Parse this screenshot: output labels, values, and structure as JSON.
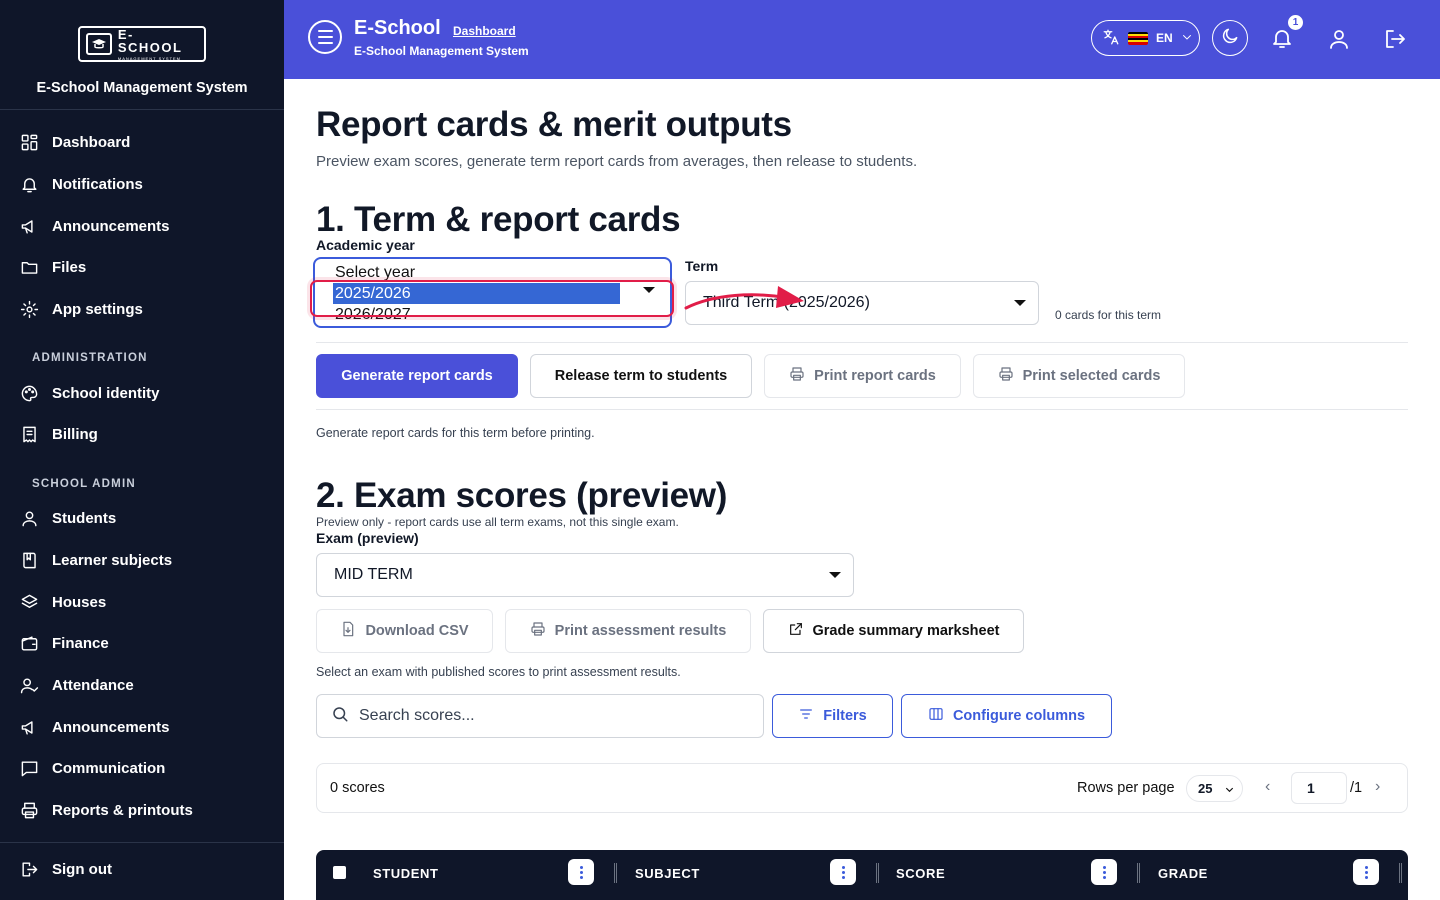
{
  "sidebar": {
    "logo_text": "E-SCHOOL",
    "logo_sub": "MANAGEMENT SYSTEM",
    "brand_name": "E-School Management System",
    "items_top": [
      {
        "label": "Dashboard",
        "icon": "dashboard-icon"
      },
      {
        "label": "Notifications",
        "icon": "bell-icon"
      },
      {
        "label": "Announcements",
        "icon": "megaphone-icon"
      },
      {
        "label": "Files",
        "icon": "folder-icon"
      },
      {
        "label": "App settings",
        "icon": "gear-icon"
      }
    ],
    "section_admin": "ADMINISTRATION",
    "items_admin": [
      {
        "label": "School identity",
        "icon": "palette-icon"
      },
      {
        "label": "Billing",
        "icon": "receipt-icon"
      }
    ],
    "section_school": "SCHOOL ADMIN",
    "items_school": [
      {
        "label": "Students",
        "icon": "user-icon"
      },
      {
        "label": "Learner subjects",
        "icon": "book-icon"
      },
      {
        "label": "Houses",
        "icon": "layers-icon"
      },
      {
        "label": "Finance",
        "icon": "wallet-icon"
      },
      {
        "label": "Attendance",
        "icon": "user-check-icon"
      },
      {
        "label": "Announcements",
        "icon": "megaphone-icon"
      },
      {
        "label": "Communication",
        "icon": "message-icon"
      },
      {
        "label": "Reports & printouts",
        "icon": "printer-icon"
      }
    ],
    "sign_out": "Sign out"
  },
  "header": {
    "title": "E-School",
    "breadcrumb": "Dashboard",
    "subtitle": "E-School Management System",
    "language": "EN",
    "notification_count": "1",
    "accent_color": "#4a50d9"
  },
  "main": {
    "title": "Report cards & merit outputs",
    "description": "Preview exam scores, generate term report cards from averages, then release to students.",
    "section1": {
      "title": "1. Term & report cards",
      "year_label": "Academic year",
      "year_options": [
        "Select year",
        "2025/2026",
        "2026/2027"
      ],
      "year_selected": "2025/2026",
      "term_label": "Term",
      "term_value": "Third Term (2025/2026)",
      "cards_note": "0 cards for this term",
      "buttons": {
        "generate": "Generate report cards",
        "release": "Release term to students",
        "print": "Print report cards",
        "print_selected": "Print selected cards"
      },
      "hint": "Generate report cards for this term before printing."
    },
    "section2": {
      "title": "2. Exam scores (preview)",
      "note": "Preview only - report cards use all term exams, not this single exam.",
      "exam_label": "Exam (preview)",
      "exam_value": "MID TERM",
      "buttons": {
        "csv": "Download CSV",
        "print_assessment": "Print assessment results",
        "grade_summary": "Grade summary marksheet",
        "filters": "Filters",
        "configure": "Configure columns"
      },
      "hint": "Select an exam with published scores to print assessment results.",
      "search_placeholder": "Search scores...",
      "count": "0 scores",
      "rows_per_page_label": "Rows per page",
      "rows_per_page": "25",
      "page": "1",
      "page_total": "/1",
      "columns": [
        "STUDENT",
        "SUBJECT",
        "SCORE",
        "GRADE"
      ]
    }
  }
}
